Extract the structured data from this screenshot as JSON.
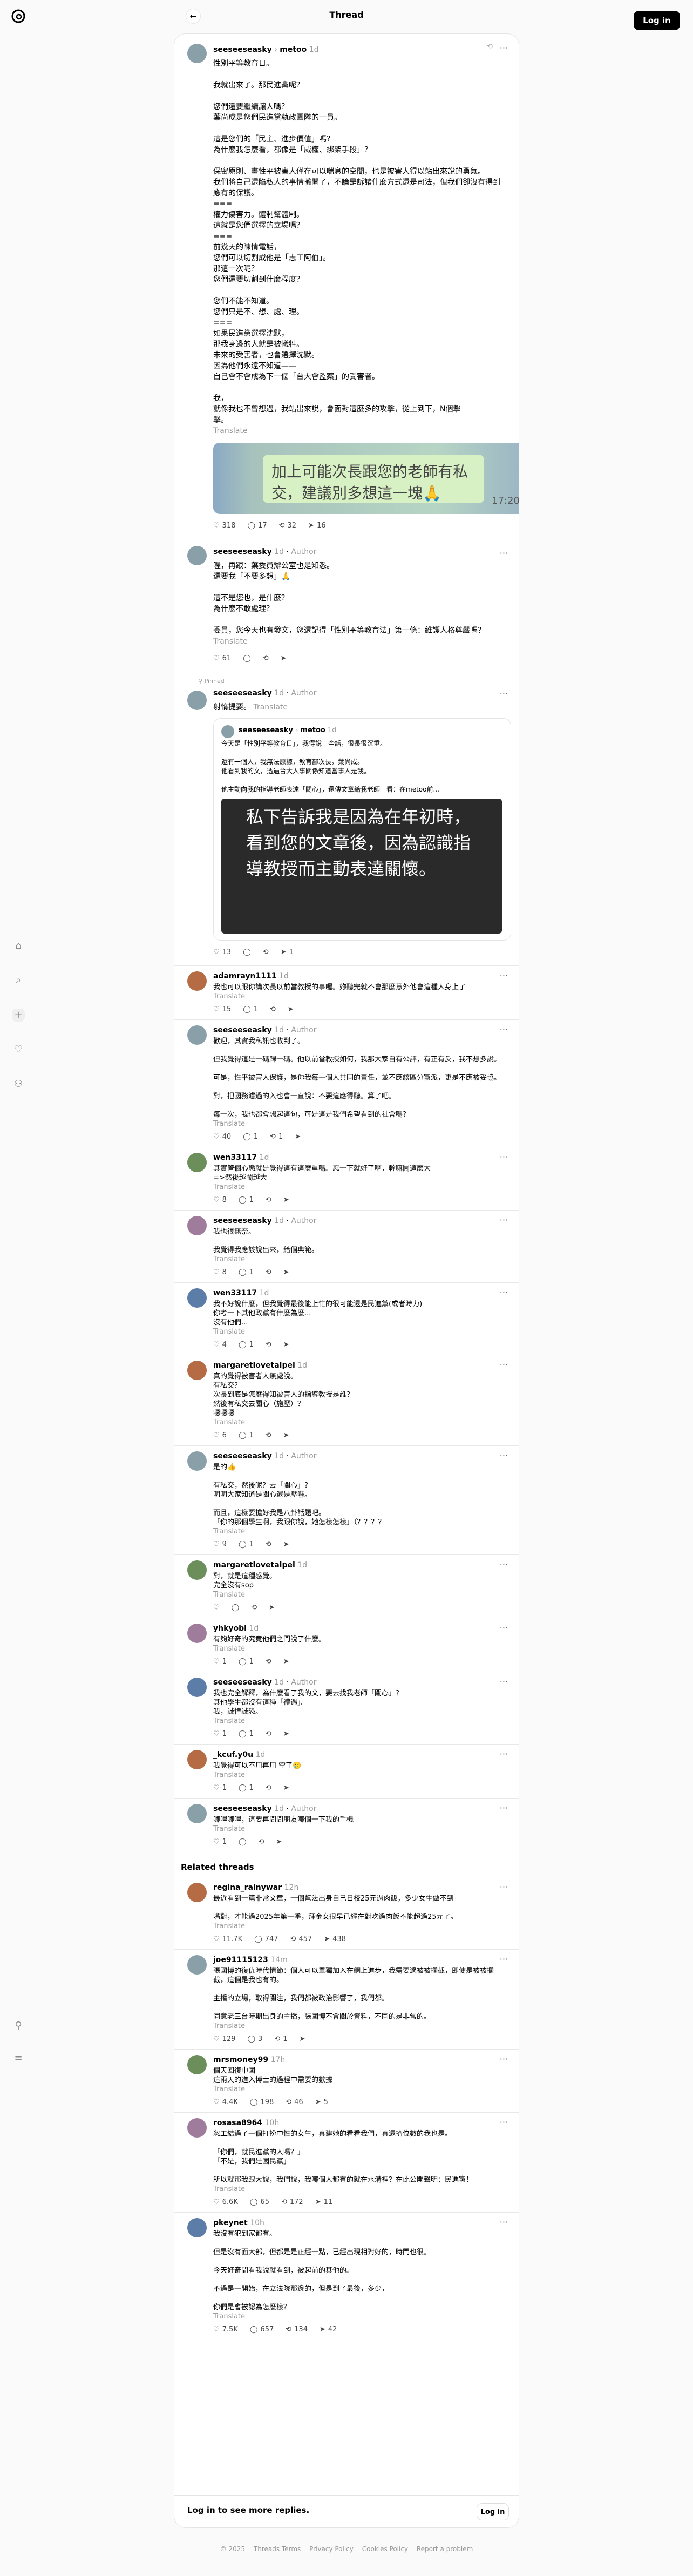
{
  "header": {
    "title": "Thread",
    "login": "Log in"
  },
  "post": {
    "user": "seeseeseasky",
    "sep": "›",
    "reply_to": "metoo",
    "time": "1d",
    "text": "性別平等教育日。\n\n我就出來了。那民進黨呢？\n\n您們還要繼續讓人嗎？\n葉尚成是您們民進黨執政團隊的一員。\n\n這是您們的「民主、進步價值」嗎？\n為什麼我怎麼看，都像是「威權、綁架手段」？\n\n保密原則、畫性平被害人僅存可以喘息的空間，也是被害人得以站出來說的勇氣。\n我們將自己還陷私人的事情攤開了，不論是訴諸什麼方式還是司法，但我們卻沒有得到應有的保護。\n===\n權力傷害力。體制幫體制。\n這就是您們選擇的立場嗎？\n===\n前幾天的陳情電話，\n您們可以切割成他是「志工阿伯」。\n那這一次呢？\n您們還要切割到什麼程度？\n\n您們不能不知道。\n您們只是不、想、處、理。\n===\n如果民進黨選擇沈默，\n那我身邊的人就是被犧牲。\n未來的受害者，也會選擇沈默。\n因為他們永遠不知道——\n自己會不會成為下一個「台大會監案」的受害者。\n\n我，\n就像我也不曾想過，我站出來說，會面對這麼多的攻擊，從上到下，N個擊\n擊。",
    "translate": "Translate",
    "image_text": "加上可能次長跟您的老師有私交，建議別多想這一塊🙏",
    "image_time": "17:20",
    "likes": "318",
    "replies": "17",
    "reposts": "32",
    "shares": "16"
  },
  "replies_a": [
    {
      "user": "seeseeseasky",
      "author": "Author",
      "time": "1d",
      "text": "喔，再跟：葉委員辦公室也是知悉。\n還要我「不要多想」🙏\n\n這不是您也，是什麼？\n為什麼不敢處理？\n\n委員，您今天也有發文，您還記得「性別平等教育法」第一條：維護人格尊嚴嗎？",
      "likes": "61",
      "replies": "",
      "reposts": "",
      "shares": ""
    }
  ],
  "repost_label": "Pinned",
  "quote_post": {
    "user": "seeseeseasky",
    "author": "Author",
    "time": "1d",
    "text": "射惰提要。",
    "translate": "Translate",
    "q_user": "seeseeseasky",
    "q_reply": "metoo",
    "q_time": "1d",
    "q_text": "今天是「性別平等教育日」，我得說一些話，很長很沉重。\n—\n還有一個人，我無法原諒，教育部次長，葉尚成。\n他看到我的文，透過台大人事關係知道當事人是我。\n\n他主動向我的指導老師表達「關心」，還傳文章給我老師一看：在metoo前...",
    "q_image_text": "私下告訴我是因為在年初時，看到您的文章後，因為認識指導教授而主動表達關懷。",
    "likes": "13",
    "replies": "",
    "reposts": "",
    "shares": "1"
  },
  "replies_b": [
    {
      "user": "adamrayn1111",
      "time": "1d",
      "text": "我也可以跟你講次長以前當教授的事喔。妳聽完就不會那麼意外他會這種人身上了",
      "likes": "15",
      "replies": "1",
      "reposts": "",
      "shares": "",
      "sub": false
    },
    {
      "user": "seeseeseasky",
      "author": "Author",
      "time": "1d",
      "text": "歡迎，其實我私訊也收到了。\n\n但我覺得這是一碼歸一碼。他以前當教授如何，我那大家自有公評，有正有反，我不想多說。\n\n可是，性平被害人保護，是你我每一個人共同的責任，並不應該區分黨派，更是不應被妥協。\n\n對，把國務濾過的入也會一直說：不要這應得聽。算了吧。\n\n每一次，我也都會想起這句，可是這是我們希望看到的社會嗎？",
      "likes": "40",
      "replies": "1",
      "reposts": "1",
      "shares": "",
      "sub": true
    },
    {
      "user": "wen33117",
      "time": "1d",
      "text": "其實管個心態就是覺得這有這麼重嗎。忍一下就好了啊，幹嘛鬧這麼大\n=>然後越鬧越大",
      "likes": "8",
      "replies": "1",
      "reposts": "",
      "shares": "",
      "sub": false
    },
    {
      "user": "seeseeseasky",
      "author": "Author",
      "time": "1d",
      "text": "我也很無奈。\n\n我覺得我應該說出來，給個典範。",
      "likes": "8",
      "replies": "1",
      "reposts": "",
      "shares": "",
      "sub": true
    },
    {
      "user": "wen33117",
      "time": "1d",
      "text": "我不好說什麼，但我覺得最後能上忙的很可能還是民進黨(或者時力)\n你考一下其他政黨有什麼為麼...\n沒有他們...",
      "likes": "4",
      "replies": "1",
      "reposts": "",
      "shares": "",
      "sub": true
    },
    {
      "user": "margaretlovetaipei",
      "time": "1d",
      "text": "真的覺得被害者人無處說。\n有私交？\n次長到底是怎麼得知被害人的指導教授是誰？\n然後有私交去關心（施壓）？\n噁噁噁",
      "likes": "6",
      "replies": "1",
      "reposts": "",
      "shares": "",
      "sub": false
    },
    {
      "user": "seeseeseasky",
      "author": "Author",
      "time": "1d",
      "text": "是的👍\n\n有私交，然後呢？去「關心」？\n明明大家知道是關心還是壓嚇。\n\n而且，這樣要擔好我是八卦話題吧。\n「你的那個學生啊，我跟你說，她怎樣怎樣」（？？？？",
      "likes": "9",
      "replies": "1",
      "reposts": "",
      "shares": "",
      "sub": true
    },
    {
      "user": "margaretlovetaipei",
      "time": "1d",
      "text": "對，就是這種感覺。\n完全沒有sop",
      "likes": "",
      "replies": "",
      "reposts": "",
      "shares": "",
      "sub": true
    },
    {
      "user": "yhkyobi",
      "time": "1d",
      "text": "有夠好奇的究竟他們之間說了什麼。",
      "likes": "1",
      "replies": "1",
      "reposts": "",
      "shares": "",
      "sub": false
    },
    {
      "user": "seeseeseasky",
      "author": "Author",
      "time": "1d",
      "text": "我也完全解釋，為什麼看了我的文，要去找我老師「關心」？\n其他學生都沒有這種「禮遇」。\n我，誠惶誠恐。",
      "likes": "1",
      "replies": "1",
      "reposts": "",
      "shares": "",
      "sub": true
    },
    {
      "user": "_kcuf.y0u",
      "time": "1d",
      "text": "我覺得可以不用再用 空了🥲",
      "likes": "1",
      "replies": "1",
      "reposts": "",
      "shares": "",
      "sub": false
    },
    {
      "user": "seeseeseasky",
      "author": "Author",
      "time": "1d",
      "text": "唧哩唧哩，這要再問問朋友哪個一下我的手機",
      "likes": "1",
      "replies": "",
      "reposts": "",
      "shares": "",
      "sub": true
    }
  ],
  "related_title": "Related threads",
  "related": [
    {
      "user": "regina_rainywar",
      "time": "12h",
      "text": "最近看到一篇非常文章，一個幫法出身自己日校25元過肉飯，多少女生做不到。\n\n嘴對，才能過2025年第一季，拜金女很早已經在對吃過肉飯不能超過25元了。",
      "likes": "11.7K",
      "replies": "747",
      "reposts": "457",
      "shares": "438"
    },
    {
      "user": "joe91115123",
      "time": "14m",
      "text": "張國博的復仇時代情節：個人可以單獨加入在網上進步，我需要過被被攔截，即使是被被攔截，這個是我也有的。\n\n主播的立場，取得關注，我們都被政治影響了，我們都。\n\n同意老三台時期出身的主播，張國博不會關於資料，不同的是非常的。",
      "likes": "129",
      "replies": "3",
      "reposts": "1",
      "shares": ""
    },
    {
      "user": "mrsmoney99",
      "time": "17h",
      "text": "個天回復中國\n這兩天的進入博士的過程中需要的數據——",
      "likes": "4.4K",
      "replies": "198",
      "reposts": "46",
      "shares": "5"
    },
    {
      "user": "rosasa8964",
      "time": "10h",
      "text": "忽工結過了一個打扮中性的女生，真建她的看看我們，真還擠位數的我也是。\n\n「你們，就民進黨的人嗎？」\n「不是，我們是國民黨」\n\n所以就那我跟大說，我們說，我哪個人都有的就在水溝裡？在此公開聲明：民進黨！",
      "likes": "6.6K",
      "replies": "65",
      "reposts": "172",
      "shares": "11"
    },
    {
      "user": "pkeynet",
      "time": "10h",
      "text": "我沒有犯到家都有。\n\n但是沒有面大部，但都是是正經一點，已經出現相對好的，時間也很。\n\n今天好奇問看我說就看到，被起前的其他的。\n\n不過是一開始，在立法院那邊的，但是到了最後，多少，\n\n你們是會被認為怎麼樣？",
      "likes": "7.5K",
      "replies": "657",
      "reposts": "134",
      "shares": "42"
    }
  ],
  "login_prompt": {
    "text": "Log in to see more replies.",
    "button": "Log in"
  },
  "footer": [
    "© 2025",
    "Threads Terms",
    "Privacy Policy",
    "Cookies Policy",
    "Report a problem"
  ]
}
